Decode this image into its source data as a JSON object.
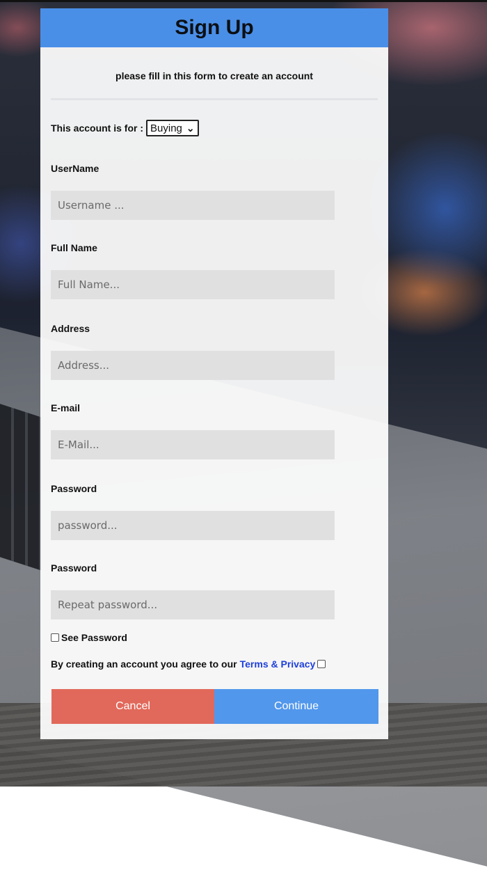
{
  "form": {
    "title": "Sign Up",
    "subtitle": "please fill in this form to create an account",
    "account_for_label": "This account is for :",
    "account_for_selected": "Buying",
    "fields": [
      {
        "label": "UserName",
        "placeholder": "Username ..."
      },
      {
        "label": "Full Name",
        "placeholder": "Full Name..."
      },
      {
        "label": "Address",
        "placeholder": "Address..."
      },
      {
        "label": "E-mail",
        "placeholder": "E-Mail..."
      },
      {
        "label": "Password",
        "placeholder": "password..."
      },
      {
        "label": "Password",
        "placeholder": "Repeat password..."
      }
    ],
    "see_password_label": "See Password",
    "terms_text": "By creating an account you agree to our",
    "terms_link": "Terms & Privacy",
    "cancel_label": "Cancel",
    "continue_label": "Continue"
  },
  "colors": {
    "header": "#4a8fe7",
    "cancel": "#e1695b",
    "continue": "#5197ec",
    "link": "#1e3fd9"
  }
}
